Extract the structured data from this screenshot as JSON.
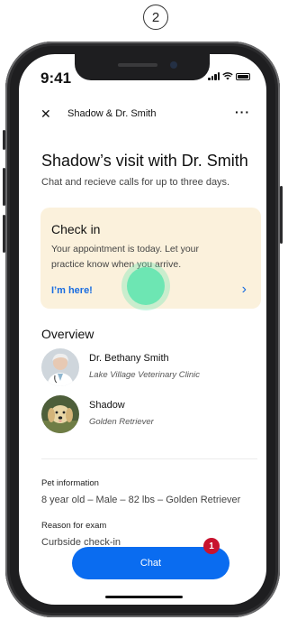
{
  "step_number": "2",
  "status_bar": {
    "time": "9:41"
  },
  "nav": {
    "title": "Shadow & Dr. Smith",
    "close_icon": "close-icon",
    "more_icon": "more-icon"
  },
  "header": {
    "title": "Shadow’s visit with Dr. Smith",
    "subtitle": "Chat and recieve calls for up to three days."
  },
  "checkin": {
    "title": "Check in",
    "text": "Your appointment is today. Let your practice know when you arrive.",
    "link": "I’m here!"
  },
  "overview": {
    "title": "Overview",
    "items": [
      {
        "name": "Dr. Bethany Smith",
        "detail": "Lake Village Veterinary Clinic"
      },
      {
        "name": "Shadow",
        "detail": "Golden Retriever"
      }
    ]
  },
  "pet_info": {
    "label": "Pet information",
    "value": "8 year old – Male – 82 lbs – Golden Retriever"
  },
  "reason": {
    "label": "Reason for exam",
    "value": "Curbside check-in"
  },
  "chat": {
    "label": "Chat",
    "badge": "1"
  },
  "colors": {
    "accent": "#0a6cf0",
    "checkin_bg": "#fbf1dc",
    "badge": "#c8132f",
    "touch": "#6de6b3"
  }
}
